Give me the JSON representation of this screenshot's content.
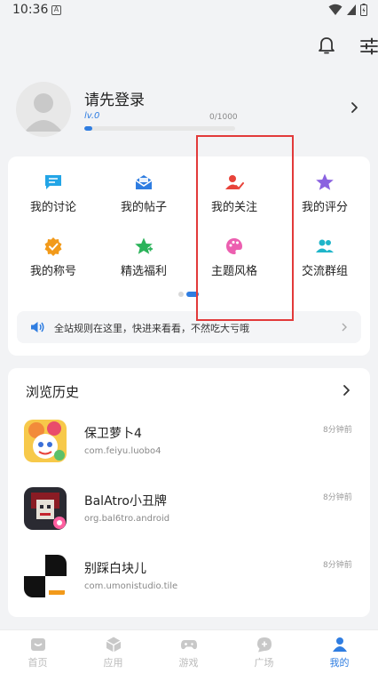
{
  "status_bar": {
    "time": "10:36",
    "notification_glyph": "A"
  },
  "header": {
    "icons": [
      "bell-icon",
      "tune-icon"
    ]
  },
  "profile": {
    "title": "请先登录",
    "level": "lv.0",
    "exp": "0/1000",
    "progress_fraction": 0.05
  },
  "menu": {
    "items": [
      {
        "label": "我的讨论",
        "icon": "chat-icon",
        "color": "#23a5e6"
      },
      {
        "label": "我的帖子",
        "icon": "mail-icon",
        "color": "#2f7de1"
      },
      {
        "label": "我的关注",
        "icon": "person-check-icon",
        "color": "#e8433a"
      },
      {
        "label": "我的评分",
        "icon": "star-icon",
        "color": "#8a62e0"
      },
      {
        "label": "我的称号",
        "icon": "badge-icon",
        "color": "#f29a1a"
      },
      {
        "label": "精选福利",
        "icon": "star-plus-icon",
        "color": "#2bb35a"
      },
      {
        "label": "主题风格",
        "icon": "palette-icon",
        "color": "#ec5fb0"
      },
      {
        "label": "交流群组",
        "icon": "group-icon",
        "color": "#1fb5c9"
      }
    ],
    "notice": "全站规则在这里，快进来看看，不然吃大亏哦"
  },
  "history": {
    "title": "浏览历史",
    "items": [
      {
        "name": "保卫萝卜4",
        "package": "com.feiyu.luobo4",
        "time": "8分钟前"
      },
      {
        "name": "BalAtro小丑牌",
        "package": "org.bal6tro.android",
        "time": "8分钟前"
      },
      {
        "name": "别踩白块儿",
        "package": "com.umonistudio.tile",
        "time": "8分钟前"
      }
    ]
  },
  "nav": {
    "items": [
      {
        "label": "首页"
      },
      {
        "label": "应用"
      },
      {
        "label": "游戏"
      },
      {
        "label": "广场"
      },
      {
        "label": "我的"
      }
    ],
    "active_color": "#2f7de1",
    "inactive_color": "#bbbbbb"
  }
}
